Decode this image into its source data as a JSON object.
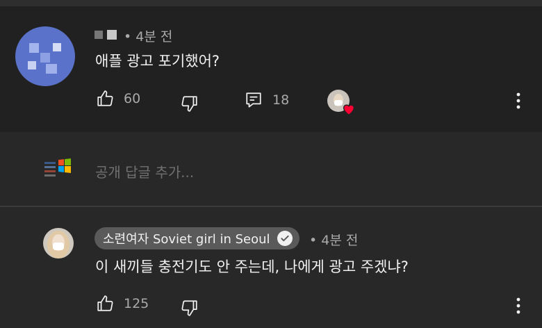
{
  "comments": [
    {
      "author": "",
      "time": "4분 전",
      "text": "애플 광고 포기했어?",
      "likes": "60",
      "replies": "18"
    },
    {
      "author": "소련여자 Soviet girl in Seoul",
      "time": "4분 전",
      "text": "이 새끼들 충전기도 안 주는데, 나에게 광고 주겠냐?",
      "likes": "125"
    }
  ],
  "reply_box": {
    "placeholder": "공개 답글 추가..."
  },
  "icons": [
    "like-icon",
    "dislike-icon",
    "reply-icon",
    "more-vert-icon",
    "heart-icon",
    "verified-check-icon"
  ],
  "colors": {
    "heart": "#ff0033",
    "background": "#282828",
    "card": "#212121"
  }
}
